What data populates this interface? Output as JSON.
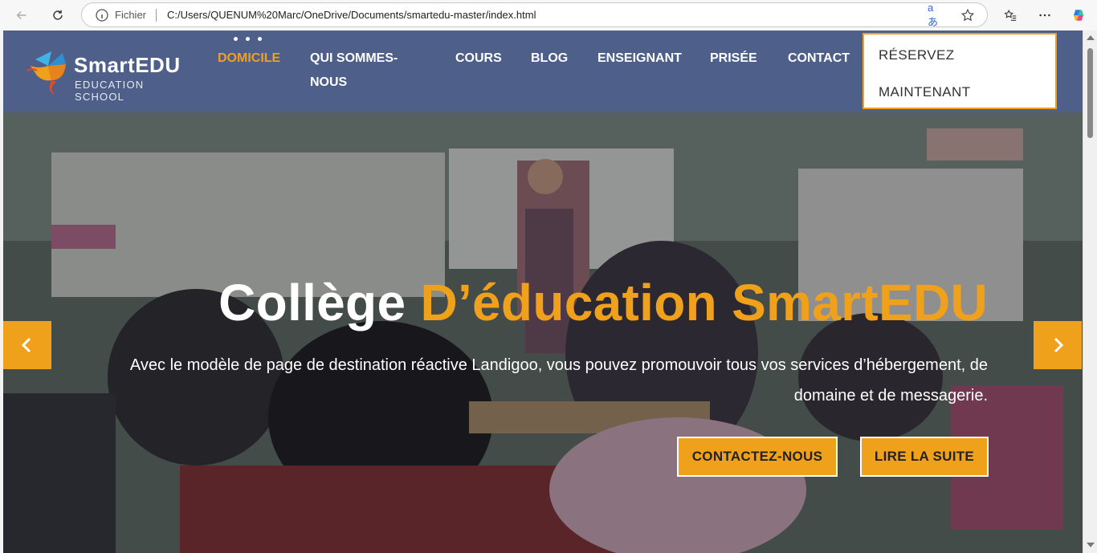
{
  "browser": {
    "address_prefix": "Fichier",
    "url": "C:/Users/QUENUM%20Marc/OneDrive/Documents/smartedu-master/index.html",
    "read_aloud_glyph": "aあ"
  },
  "site": {
    "logo": {
      "title": "SmartEDU",
      "subtitle": "EDUCATION SCHOOL"
    },
    "menu": [
      {
        "label": "DOMICILE",
        "active": true
      },
      {
        "label": "QUI SOMMES-",
        "label2": "NOUS"
      },
      {
        "label": "COURS"
      },
      {
        "label": "BLOG"
      },
      {
        "label": "ENSEIGNANT"
      },
      {
        "label": "PRISÉE"
      },
      {
        "label": "CONTACT"
      }
    ],
    "reserve": {
      "line1": "RÉSERVEZ",
      "line2": "MAINTENANT"
    }
  },
  "hero": {
    "title_plain": "Collège ",
    "title_highlight": "D’éducation SmartEDU",
    "text": "Avec le modèle de page de destination réactive Landigoo, vous pouvez promouvoir tous vos services d’hébergement, de domaine et de messagerie.",
    "btn_contact": "CONTACTEZ-NOUS",
    "btn_more": "LIRE LA SUITE"
  },
  "colors": {
    "header": "#4e5f8a",
    "accent": "#f0a11c"
  }
}
